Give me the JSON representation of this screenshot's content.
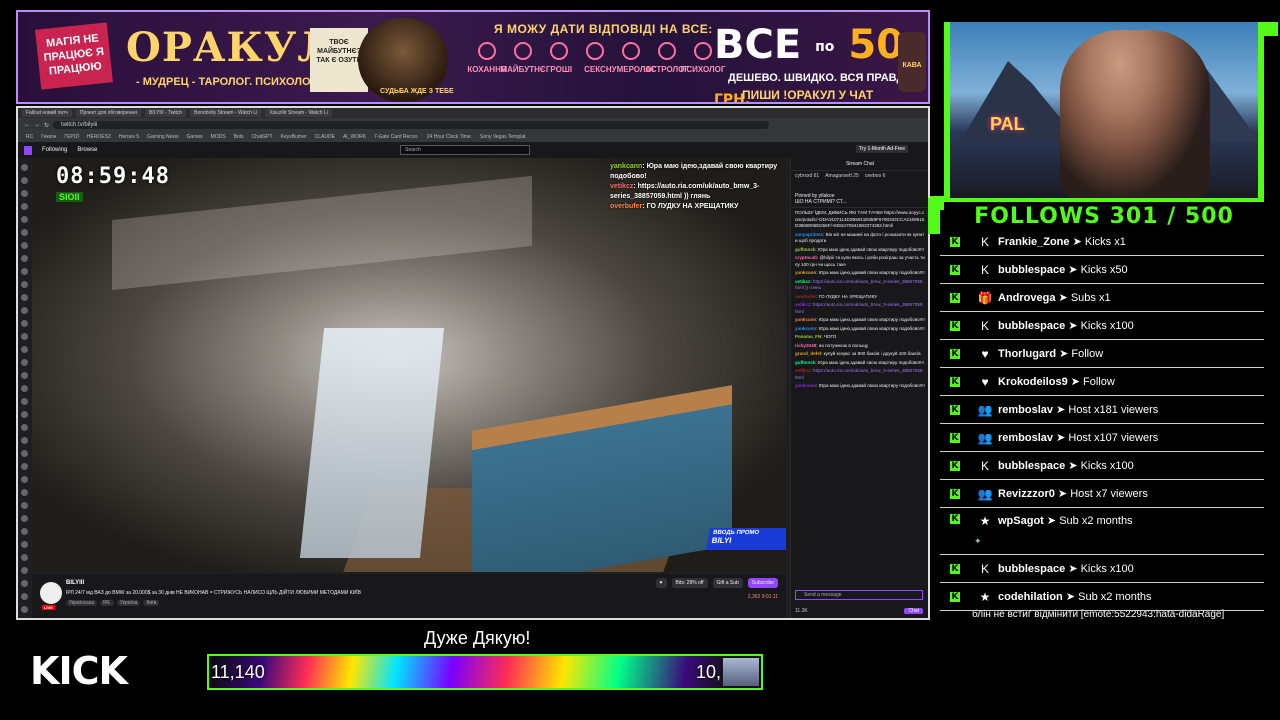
{
  "banner": {
    "left_tag": "МАГІЯ НЕ ПРАЦЮЄ Я ПРАЦЮЮ",
    "title": "ОРАКУЛ",
    "subtitle": "- МУДРЕЦ - ТАРОЛОГ. ПСИХОЛОГ -",
    "question_card": "ТВОЄ МАЙБУТНЄ? ТАК Є ОЗУТИ",
    "wizard_caption": "СУДЬБА ЖДЕ З ТЕБЕ",
    "headline": "Я МОЖУ ДАТИ ВІДПОВІДІ НА ВСЕ:",
    "categories": [
      "КОХАННЯ",
      "МАЙБУТНЄ",
      "ГРОШІ",
      "СЕКС",
      "НУМЕРОЛОГ",
      "АСТРОЛОГ",
      "ПСИХОЛОГ"
    ],
    "price_prefix": "ВСЕ",
    "price_po": "по",
    "price_number": "50",
    "price_currency": "ГРН.",
    "tagline": "ДЕШЕВО. ШВИДКО. ВСЯ ПРАВДА.",
    "cta": "ПИШИ !ОРАКУЛ У ЧАТ",
    "jar_label": "КАВА"
  },
  "browser": {
    "tabs": [
      "Fallout новий патч",
      "Проект для обговорення",
      "BILYIII - Twitch",
      "Bonobolly Stream - Watch Li",
      "Xsiuzilir Stream - Watch Li"
    ],
    "url": "twitch.tv/bilyiii",
    "bookmarks": [
      "RC",
      "Геккон",
      "ГЕРОЇ",
      "HEROES3",
      "Heroes 5",
      "Gaming News",
      "Games",
      "MODS",
      "Bots",
      "ChatGPT",
      "KeysBurner",
      "CLAUDE",
      "AI_WORK",
      "7-Gate Card Recon.",
      "24 Hour Clock Time.",
      "Sony Vegas Templat."
    ],
    "nav_following": "Following",
    "nav_browse": "Browse",
    "search_placeholder": "Search",
    "ad_free": "Try 1-Month Ad-Free"
  },
  "video": {
    "clock": "08:59:48",
    "clock_sub": "SIOII",
    "badge_text": "ВВОДЬ ПРОМО",
    "badge_name": "BILYI",
    "overlay_chat": [
      {
        "user": "yankcann",
        "text": "Юра маю ідею,здавай свою квартиру подобово!"
      },
      {
        "user": "vetikcz",
        "text": "https://auto.ria.com/uk/auto_bmw_3-series_38857059.html )) глянь"
      },
      {
        "user": "overbufer",
        "text": "ГО ЛУДКУ НА ХРЕЩАТИКУ"
      }
    ]
  },
  "stream_info": {
    "name": "BILYIII",
    "live": "LIVE",
    "title": "ІРЛ 24/7 від ВАЗ до BMW за 20.000$ за 30 днів НЕ ВИКОНАВ = СТРИЖУСЬ НАЛИСО ЩЛЬ ДІЙТИ ЛЮБИМИ МЕТОДАМИ КИЇВ",
    "tags": [
      "Українська",
      "IRL",
      "Україна",
      "Київ"
    ],
    "bits": "Bits: 28% off",
    "gift": "Gift a Sub",
    "subscribe": "Subscribe",
    "viewers": "2,362",
    "uptime": "9:01:11"
  },
  "twitch_chat": {
    "header": "Stream Chat",
    "leaders": [
      {
        "name": "cybrxxd",
        "value": "61"
      },
      {
        "name": "Amaganxett",
        "value": "25"
      },
      {
        "name": "ceeboo",
        "value": "6"
      }
    ],
    "pinned_by": "Pinned by ytlakoe",
    "pinned_text": "ШО НА СТРИМІ? СТ...",
    "messages": [
      {
        "user": "",
        "text": "ПОЛЬЗУ ЇДЕМ, ДИВИСЬ ЯКІ ТАМ ТАЧКИ https://www.ooyyc.com/potal/c/-ODA3107114D2B5911E858F6790343CCA2169915D3868006ED56F/-9393470941883374382.html/"
      },
      {
        "user": "sanyaprime1",
        "text": "Він міг не машині на фото і розказати як купити щоб продати"
      },
      {
        "user": "guflmnsk",
        "text": "Юра маю ідею,здавай свою квартиру подобово!!!!"
      },
      {
        "user": "cryptocab",
        "text": "@bilyiii та купи якось і роби розіграш за участь типу 100 грн чи щось таке"
      },
      {
        "user": "yankcann",
        "text": "Юра маю ідею,здавай свою квартиру подобово!!!!"
      },
      {
        "user": "vetikcz",
        "text": "https://auto.ria.com/uk/auto_bmw_3-series_38857059.html )) глянь"
      },
      {
        "user": "overbufer",
        "text": "ГО ЛУДКУ НА ХРЕЩАТИКУ"
      },
      {
        "user": "vetikcz",
        "text": "https://auto.ria.com/uk/auto_bmw_3-series_38857059.html"
      },
      {
        "user": "yankcann",
        "text": "Юра маю ідею,здавай свою квартиру подобово!!!!"
      },
      {
        "user": "yankcann",
        "text": "Юра маю ідею,здавай свою квартиру подобово!!!!"
      },
      {
        "user": "Panama_FN",
        "text": "ЧОГО"
      },
      {
        "user": "richy2048",
        "text": "на потужнюю в польщу"
      },
      {
        "user": "grand_defel",
        "text": "купуй ксеркс за 900 баксів і друкуй 100 баксів"
      },
      {
        "user": "guflmnsk",
        "text": "Юра маю ідею,здавай свою квартиру подобово!!!!"
      },
      {
        "user": "vetikcz",
        "text": "https://auto.ria.com/uk/auto_bmw_3-series_38857059.html"
      },
      {
        "user": "yankcann",
        "text": "Юра маю ідею,здавай свою квартиру подобово!!!!"
      }
    ],
    "input_placeholder": "Send a message",
    "points": "11.3K",
    "chat_button": "Chat"
  },
  "cam": {
    "sign_text": "PAL"
  },
  "follows": {
    "label": "FOLLOWS 301 / 500"
  },
  "events": [
    {
      "icon": "kick-icon",
      "user": "Frankie_Zone",
      "action": "Kicks x1"
    },
    {
      "icon": "kick-icon",
      "user": "bubblespace",
      "action": "Kicks x50"
    },
    {
      "icon": "gift-icon",
      "user": "Androvega",
      "action": "Subs x1"
    },
    {
      "icon": "kick-icon",
      "user": "bubblespace",
      "action": "Kicks x100"
    },
    {
      "icon": "heart-icon",
      "user": "Thorlugard",
      "action": "Follow"
    },
    {
      "icon": "heart-icon",
      "user": "Krokodeilos9",
      "action": "Follow"
    },
    {
      "icon": "host-icon",
      "user": "remboslav",
      "action": "Host x181 viewers"
    },
    {
      "icon": "host-icon",
      "user": "remboslav",
      "action": "Host x107 viewers"
    },
    {
      "icon": "kick-icon",
      "user": "bubblespace",
      "action": "Kicks x100"
    },
    {
      "icon": "host-icon",
      "user": "Revizzzor0",
      "action": "Host x7 viewers"
    },
    {
      "icon": "star-icon",
      "user": "wpSagot",
      "action": "Sub x2 months"
    },
    {
      "icon": "kick-icon",
      "user": "bubblespace",
      "action": "Kicks x100"
    },
    {
      "icon": "star-icon",
      "user": "codehilation",
      "action": "Sub x2 months"
    }
  ],
  "event_message": "блін не встиг відмінити [emote:5522943:hata-didaRage]",
  "arrow": "➤",
  "bottom": {
    "thanks": "Дуже Дякую!",
    "kick_logo": "KICK",
    "goal_current": "11,140",
    "goal_target": "10,"
  }
}
